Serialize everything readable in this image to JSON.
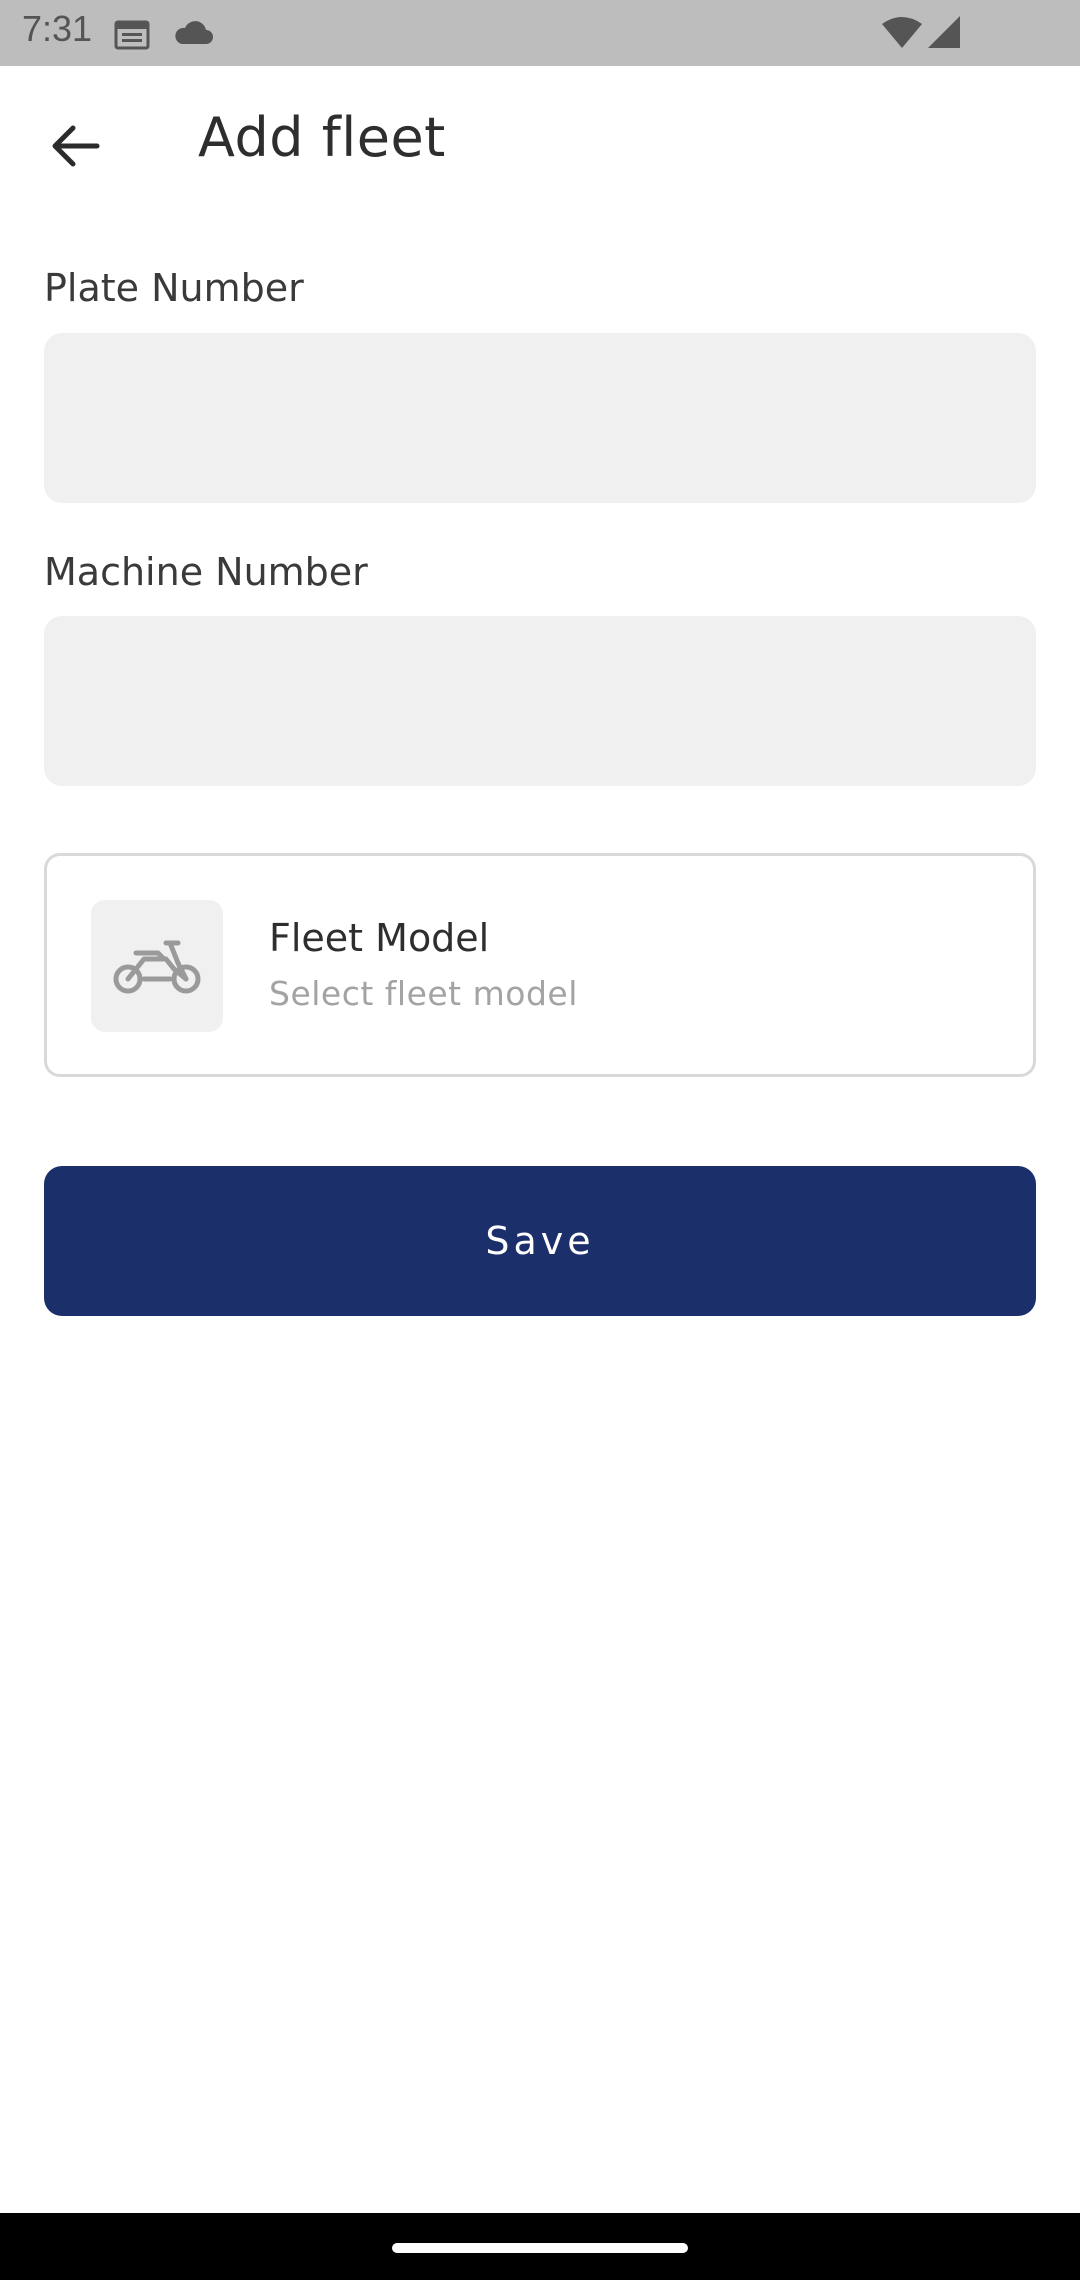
{
  "status_bar": {
    "time": "7:31",
    "icons": [
      "calendar-icon",
      "cloud-icon",
      "wifi-icon",
      "signal-icon"
    ]
  },
  "header": {
    "title": "Add fleet",
    "back_icon": "arrow-back-icon"
  },
  "form": {
    "plate_label": "Plate Number",
    "plate_value": "",
    "machine_label": "Machine Number",
    "machine_value": ""
  },
  "model_picker": {
    "title": "Fleet Model",
    "subtitle": "Select fleet model",
    "icon": "motorcycle-icon"
  },
  "actions": {
    "save_label": "Save"
  },
  "colors": {
    "primary": "#1b2f6b",
    "input_bg": "#f0f0f0",
    "status_bar_bg": "#bdbdbd",
    "muted_text": "#a3a3a3"
  }
}
